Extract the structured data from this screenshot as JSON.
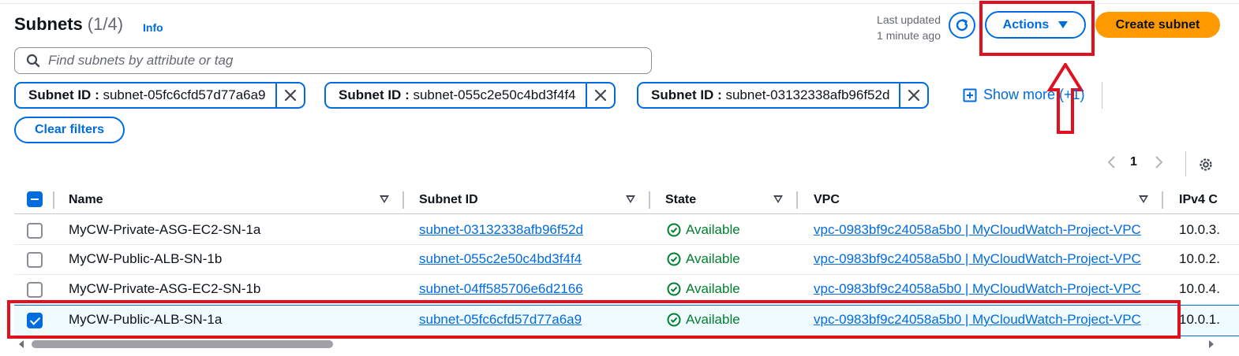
{
  "header": {
    "title": "Subnets",
    "count": "(1/4)",
    "info": "Info",
    "last_updated_line1": "Last updated",
    "last_updated_line2": "1 minute ago",
    "actions_label": "Actions",
    "create_label": "Create subnet"
  },
  "search": {
    "placeholder": "Find subnets by attribute or tag"
  },
  "filters": [
    {
      "key": "Subnet ID",
      "value": "subnet-05fc6cfd57d77a6a9"
    },
    {
      "key": "Subnet ID",
      "value": "subnet-055c2e50c4bd3f4f4"
    },
    {
      "key": "Subnet ID",
      "value": "subnet-03132338afb96f52d"
    }
  ],
  "show_more": "Show more (+1)",
  "clear_filters": "Clear filters",
  "pagination": {
    "current_page": "1"
  },
  "columns": [
    "Name",
    "Subnet ID",
    "State",
    "VPC",
    "IPv4 C"
  ],
  "rows": [
    {
      "name": "MyCW-Private-ASG-EC2-SN-1a",
      "subnet_id": "subnet-03132338afb96f52d",
      "state": "Available",
      "vpc": "vpc-0983bf9c24058a5b0 | MyCloudWatch-Project-VPC",
      "ipv4": "10.0.3.",
      "selected": false
    },
    {
      "name": "MyCW-Public-ALB-SN-1b",
      "subnet_id": "subnet-055c2e50c4bd3f4f4",
      "state": "Available",
      "vpc": "vpc-0983bf9c24058a5b0 | MyCloudWatch-Project-VPC",
      "ipv4": "10.0.2.",
      "selected": false
    },
    {
      "name": "MyCW-Private-ASG-EC2-SN-1b",
      "subnet_id": "subnet-04ff585706e6d2166",
      "state": "Available",
      "vpc": "vpc-0983bf9c24058a5b0 | MyCloudWatch-Project-VPC",
      "ipv4": "10.0.4.",
      "selected": false
    },
    {
      "name": "MyCW-Public-ALB-SN-1a",
      "subnet_id": "subnet-05fc6cfd57d77a6a9",
      "state": "Available",
      "vpc": "vpc-0983bf9c24058a5b0 | MyCloudWatch-Project-VPC",
      "ipv4": "10.0.1.",
      "selected": true
    }
  ],
  "colors": {
    "link": "#006ce0",
    "primary": "#ff9900",
    "success": "#00802f",
    "annotation": "#e0101e",
    "selected_row": "#f0fbff"
  },
  "icons": [
    "refresh-icon",
    "caret-down-icon",
    "search-icon",
    "close-icon",
    "plus-square-icon",
    "chevron-left-icon",
    "chevron-right-icon",
    "settings-icon",
    "sort-icon",
    "check-circle-icon",
    "arrow-up-annotation"
  ]
}
